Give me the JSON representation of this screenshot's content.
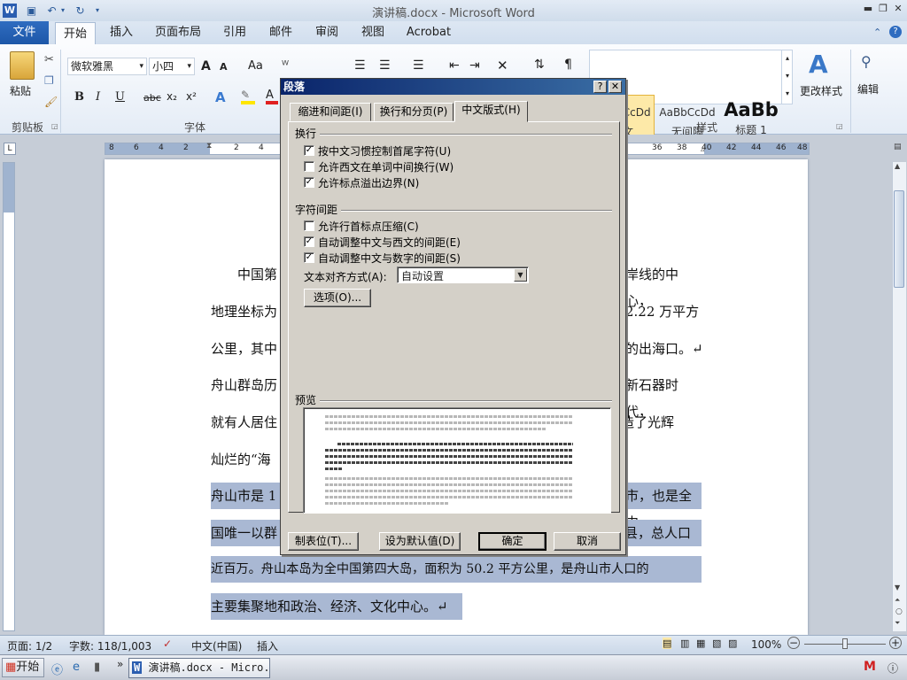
{
  "window": {
    "title": "演讲稿.docx - Microsoft Word"
  },
  "tabs": [
    {
      "label": "文件"
    },
    {
      "label": "开始"
    },
    {
      "label": "插入"
    },
    {
      "label": "页面布局"
    },
    {
      "label": "引用"
    },
    {
      "label": "邮件"
    },
    {
      "label": "审阅"
    },
    {
      "label": "视图"
    },
    {
      "label": "Acrobat"
    }
  ],
  "ribbon": {
    "clipboard": {
      "paste": "粘贴",
      "group": "剪贴板"
    },
    "font": {
      "name": "微软雅黑",
      "size": "小四",
      "group": "字体",
      "bold": "B",
      "italic": "I",
      "underline": "U",
      "strike": "abc",
      "sub": "x₂",
      "sup": "x²",
      "grow": "A",
      "shrink": "A",
      "case": "Aa"
    },
    "styles": {
      "group": "样式",
      "items": [
        {
          "preview": "AaBbCcDd",
          "name": "正文"
        },
        {
          "preview": "AaBbCcDd",
          "name": "无间隔"
        },
        {
          "preview": "AaBb",
          "name": "标题 1"
        }
      ],
      "change": "更改样式"
    },
    "edit": {
      "label": "编辑"
    }
  },
  "ruler": {
    "left_ticks": [
      "8",
      "6",
      "4",
      "2",
      "2",
      "4"
    ],
    "right_ticks": [
      "36",
      "38",
      "40",
      "42",
      "44",
      "46",
      "48"
    ]
  },
  "document": {
    "lines": [
      {
        "text": "中国第",
        "right": "岸线的中心，",
        "selected": false
      },
      {
        "text": "地理坐标为",
        "right": "2.22 万平方",
        "selected": false
      },
      {
        "text": "公里，其中",
        "right": "的出海口。↵",
        "selected": false
      },
      {
        "text": "舟山群岛历",
        "right": "新石器时代，",
        "selected": false
      },
      {
        "text": "就有人居住",
        "right": "创造了光辉",
        "selected": false
      },
      {
        "text": "灿烂的“海",
        "right": "",
        "selected": false
      },
      {
        "text": "舟山市是 1",
        "right": "市，也是全中",
        "selected": true
      },
      {
        "text": "国唯一以群",
        "right": "个县，总人口",
        "selected": true
      },
      {
        "text": "近百万。舟山本岛为全中国第四大岛，面积为 50.2 平方公里，是舟山市人口的",
        "right": "",
        "selected": true
      },
      {
        "text": "主要集聚地和政治、经济、文化中心。↵",
        "right": "",
        "selected": true
      }
    ]
  },
  "dialog": {
    "title": "段落",
    "help": "?",
    "close": "✕",
    "tabs": [
      "缩进和间距(I)",
      "换行和分页(P)",
      "中文版式(H)"
    ],
    "sections": {
      "wrap": "换行",
      "spacing": "字符间距",
      "preview": "预览"
    },
    "checkboxes": [
      {
        "label": "按中文习惯控制首尾字符(U)",
        "checked": true
      },
      {
        "label": "允许西文在单词中间换行(W)",
        "checked": false
      },
      {
        "label": "允许标点溢出边界(N)",
        "checked": true
      },
      {
        "label": "允许行首标点压缩(C)",
        "checked": false
      },
      {
        "label": "自动调整中文与西文的间距(E)",
        "checked": true
      },
      {
        "label": "自动调整中文与数字的间距(S)",
        "checked": true
      }
    ],
    "align_label": "文本对齐方式(A):",
    "align_value": "自动设置",
    "options_btn": "选项(O)...",
    "tabs_btn": "制表位(T)...",
    "default_btn": "设为默认值(D)",
    "ok_btn": "确定",
    "cancel_btn": "取消"
  },
  "status": {
    "page": "页面: 1/2",
    "words": "字数: 118/1,003",
    "lang": "中文(中国)",
    "mode": "插入",
    "zoom": "100%"
  },
  "taskbar": {
    "start": "开始",
    "app": "演讲稿.docx - Micro..."
  }
}
